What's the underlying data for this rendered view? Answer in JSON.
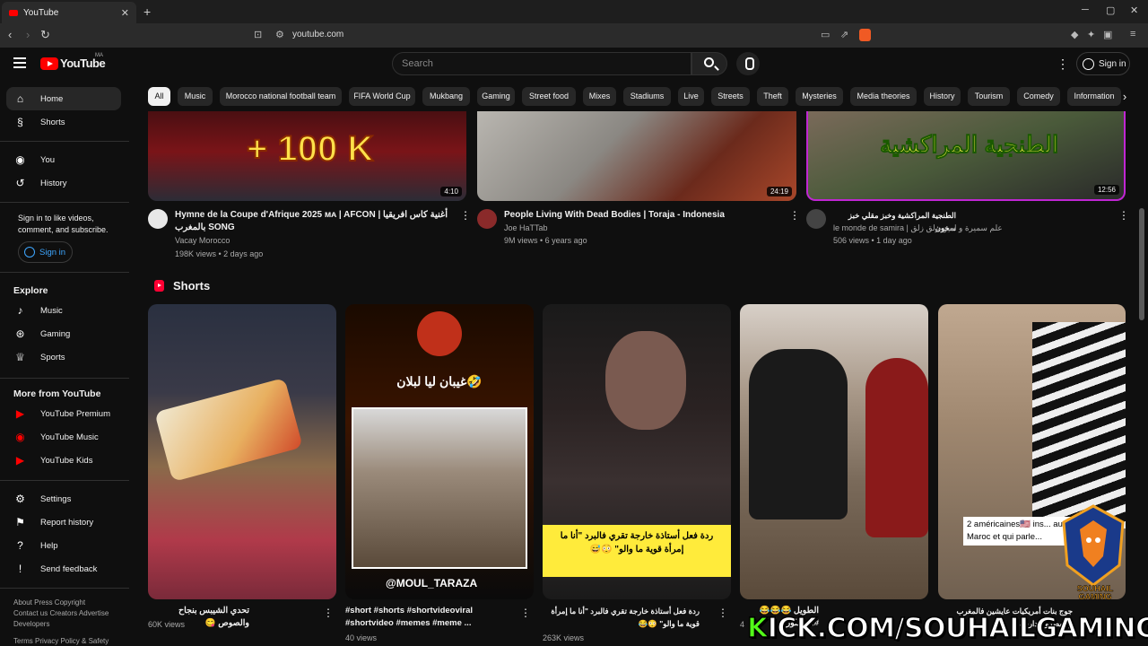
{
  "browser": {
    "tab_title": "YouTube",
    "new_tab": "+",
    "url": "youtube.com"
  },
  "masthead": {
    "logo_text": "YouTube",
    "country_code": "MA",
    "search_placeholder": "Search",
    "signin_label": "Sign in"
  },
  "sidebar": {
    "items": [
      {
        "label": "Home",
        "icon": "home-icon"
      },
      {
        "label": "Shorts",
        "icon": "shorts-icon"
      },
      {
        "label": "You",
        "icon": "you-icon"
      },
      {
        "label": "History",
        "icon": "history-icon"
      }
    ],
    "signin_prompt": "Sign in to like videos, comment, and subscribe.",
    "signin_label": "Sign in",
    "explore_heading": "Explore",
    "explore": [
      {
        "label": "Music",
        "icon": "music-icon"
      },
      {
        "label": "Gaming",
        "icon": "gaming-icon"
      },
      {
        "label": "Sports",
        "icon": "trophy-icon"
      }
    ],
    "more_heading": "More from YouTube",
    "more": [
      {
        "label": "YouTube Premium",
        "icon": "youtube-premium-icon"
      },
      {
        "label": "YouTube Music",
        "icon": "youtube-music-icon"
      },
      {
        "label": "YouTube Kids",
        "icon": "youtube-kids-icon"
      }
    ],
    "settings": [
      {
        "label": "Settings",
        "icon": "gear-icon"
      },
      {
        "label": "Report history",
        "icon": "flag-icon"
      },
      {
        "label": "Help",
        "icon": "help-icon"
      },
      {
        "label": "Send feedback",
        "icon": "feedback-icon"
      }
    ],
    "footer1": "About  Press  Copyright",
    "footer2": "Contact us  Creators  Advertise",
    "footer3": "Developers",
    "footer4": "Terms  Privacy  Policy & Safety"
  },
  "chips": [
    "All",
    "Music",
    "Morocco national football team",
    "FIFA World Cup",
    "Mukbang",
    "Gaming",
    "Street food",
    "Mixes",
    "Stadiums",
    "Live",
    "Streets",
    "Theft",
    "Mysteries",
    "Media theories",
    "History",
    "Tourism",
    "Comedy",
    "Information"
  ],
  "videos": [
    {
      "title": "Hymne de la Coupe d'Afrique 2025 ᴍᴀ | AFCON | أغنية كاس افريقيا بالمغرب SONG",
      "channel": "Vacay Morocco",
      "meta": "198K views • 2 days ago",
      "duration": "4:10",
      "thumb_text": "+ 100 K"
    },
    {
      "title": "People Living With Dead Bodies | Toraja - Indonesia",
      "channel": "Joe HaTTab",
      "meta": "9M views • 6 years ago",
      "duration": "24:19"
    },
    {
      "title": "الطنجية المراكشية وخبز مقلي خبز سخون",
      "channel": "le monde de samira | علم سميرة و امين زلق زلق",
      "meta": "506 views • 1 day ago",
      "duration": "12:56",
      "thumb_text": "الطنجية المراكشية"
    }
  ],
  "shorts_heading": "Shorts",
  "shorts": [
    {
      "title": "تحدي الشيبس بنجاح والصوص 😋",
      "views": "60K views"
    },
    {
      "title": "#short #shorts #shortvideoviral #shortvideo #memes #meme ...",
      "views": "40 views",
      "overlay": "غيبان ليا لبلان🤣",
      "handle": "@MOUL_TARAZA"
    },
    {
      "title": "ردة فعل أستاذة خارجة تقري فالبرد \"أنا ما إمرأة قوية ما والو\" 😳😂",
      "views": "263K views",
      "overlay": "ردة فعل أستاذة خارجة تقري فالبرد \"أنا ما إمرأة قوية ما والو\" 😳😅"
    },
    {
      "title": "الطويل 😂😂😂 #اكسبلور",
      "views": "4"
    },
    {
      "title": "جوج بنات أمريكيات عايشين فالمغرب وكيهضرو الدارجة",
      "views": "",
      "overlay": "2 américaines🇺🇸 ins... au Maroc et qui parle..."
    }
  ],
  "watermark": {
    "prefix": "K",
    "text": "ICK.COM/SOUHAILGAMING",
    "badge": "SOUHAIL GAMING"
  },
  "colors": {
    "accent": "#ff0000",
    "link": "#3ea6ff",
    "kick_green": "#53fc18",
    "background": "#0f0f0f"
  }
}
